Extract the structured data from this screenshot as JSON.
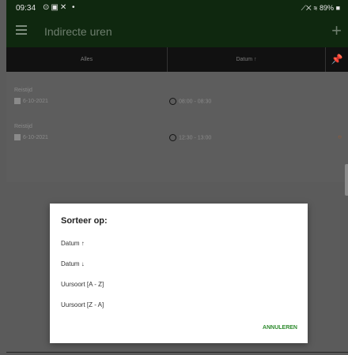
{
  "status_bar": {
    "time": "09:34",
    "battery": "89%"
  },
  "app_bar": {
    "title": "Indirecte uren",
    "add_glyph": "+"
  },
  "tabs": [
    {
      "label": "Alles"
    },
    {
      "label": "Datum ↑"
    }
  ],
  "list": [
    {
      "label": "Reistijd",
      "date": "6-10-2021",
      "start": "08:00",
      "end": "08:30",
      "warning": false
    },
    {
      "label": "Reistijd",
      "date": "6-10-2021",
      "start": "12:30",
      "end": "13:00",
      "warning": true
    }
  ],
  "dialog": {
    "title": "Sorteer op:",
    "options": [
      "Datum ↑",
      "Datum ↓",
      "Uursoort [A - Z]",
      "Uursoort [Z - A]"
    ],
    "cancel_label": "ANNULEREN"
  },
  "colors": {
    "app_bar": "#0f280f",
    "accent": "#2e8b2e",
    "warning": "#b7571e"
  },
  "icons": [
    "hamburger-menu-icon",
    "pin-icon",
    "calendar-icon",
    "clock-icon",
    "warning-icon"
  ]
}
